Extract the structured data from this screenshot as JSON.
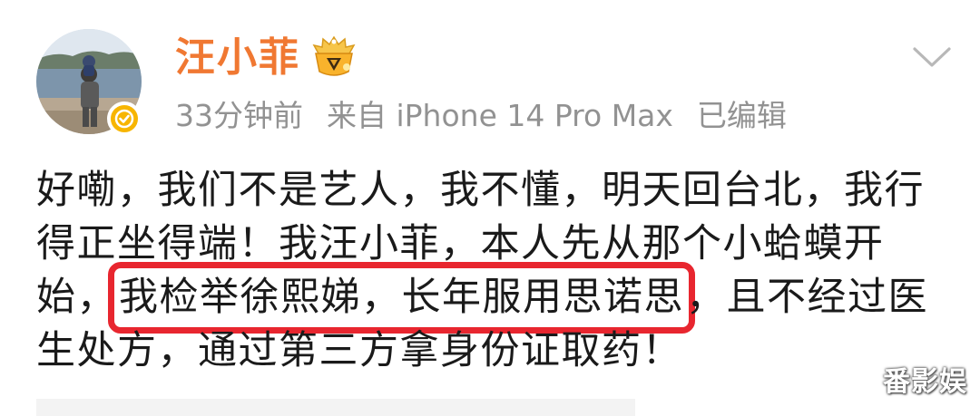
{
  "post": {
    "author": {
      "name": "汪小菲",
      "vip_icon": "crown-badge-icon",
      "verified_icon": "verified-check-icon"
    },
    "meta": {
      "time": "33分钟前",
      "source": "来自 iPhone 14 Pro Max",
      "edited": "已编辑"
    },
    "expand_icon": "chevron-down-icon",
    "body": {
      "line1": "好嘞，我们不是艺人，我不懂，明天回台北，我行",
      "line2": "得正坐得端！我汪小菲，本人先从那个小蛤蟆开",
      "line3_before": "始，",
      "line3_highlight": "我检举徐熙娣，长年服用思诺思",
      "line3_after": "，且不经过医",
      "line4": "生处方，通过第三方拿身份证取药！"
    },
    "colors": {
      "username": "#f07832",
      "meta": "#929292",
      "highlight_border": "#e8262f",
      "verified_badge": "#f7b500"
    }
  },
  "watermark": {
    "text": "番影娱"
  }
}
